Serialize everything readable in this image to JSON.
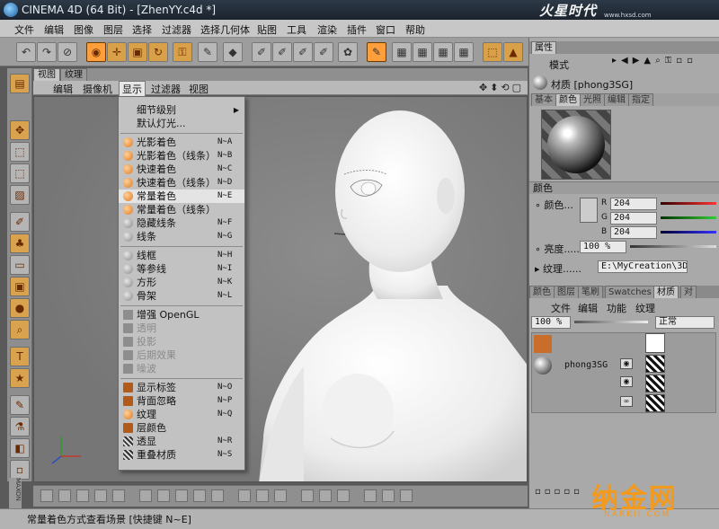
{
  "window": {
    "title": "CINEMA 4D (64 Bit) - [ZhenYY.c4d *]",
    "watermark_top": "火星时代",
    "watermark_url": "www.hxsd.com"
  },
  "menubar": [
    "文件",
    "编辑",
    "图像",
    "图层",
    "选择",
    "过滤器",
    "选择几何体",
    "贴图",
    "工具",
    "渲染",
    "插件",
    "窗口",
    "帮助"
  ],
  "toolbar": {
    "icons": [
      "undo-icon",
      "redo-icon",
      "live-select-icon",
      "move-icon",
      "scale-icon",
      "rotate-icon",
      "lock-icon",
      "tweak-icon",
      "paint-icon",
      "brush-icon",
      "fill-icon",
      "eraser-icon",
      "pick-icon",
      "grid-icon",
      "grid-icon",
      "grid-icon",
      "grid-icon",
      "grid-icon",
      "grid-icon",
      "cube-icon",
      "landscape-icon"
    ]
  },
  "viewport": {
    "tabs": [
      "视图",
      "纹理"
    ],
    "menu": [
      "编辑",
      "摄像机",
      "显示",
      "过滤器",
      "视图"
    ],
    "active_menu": "显示"
  },
  "display_menu": {
    "items": [
      {
        "label": "细节级别",
        "submenu": true
      },
      {
        "label": "默认灯光..."
      },
      {
        "label": "光影着色",
        "shortcut": "N~A"
      },
      {
        "label": "光影着色（线条）",
        "shortcut": "N~B"
      },
      {
        "label": "快速着色",
        "shortcut": "N~C"
      },
      {
        "label": "快速着色（线条）",
        "shortcut": "N~D"
      },
      {
        "label": "常量着色",
        "shortcut": "N~E",
        "highlighted": true
      },
      {
        "label": "常量着色（线条）"
      },
      {
        "label": "隐藏线条",
        "shortcut": "N~F"
      },
      {
        "label": "线条",
        "shortcut": "N~G"
      },
      {
        "label": "线框",
        "shortcut": "N~H"
      },
      {
        "label": "等参线",
        "shortcut": "N~I"
      },
      {
        "label": "方形",
        "shortcut": "N~K"
      },
      {
        "label": "骨架",
        "shortcut": "N~L"
      },
      {
        "label": "增强 OpenGL"
      },
      {
        "label": "透明",
        "disabled": true
      },
      {
        "label": "投影",
        "disabled": true
      },
      {
        "label": "后期效果",
        "disabled": true
      },
      {
        "label": "噪波",
        "disabled": true
      },
      {
        "label": "显示标签",
        "shortcut": "N~O"
      },
      {
        "label": "背面忽略",
        "shortcut": "N~P"
      },
      {
        "label": "纹理",
        "shortcut": "N~Q"
      },
      {
        "label": "层颜色"
      },
      {
        "label": "透显",
        "shortcut": "N~R"
      },
      {
        "label": "重叠材质",
        "shortcut": "N~S"
      }
    ]
  },
  "attributes": {
    "panel_title": "属性",
    "mode_label": "模式",
    "material_name": "材质 [phong3SG]",
    "tabs": [
      "基本",
      "颜色",
      "光照",
      "编辑",
      "指定"
    ],
    "active_tab": "颜色",
    "section": "颜色",
    "color_label": "颜色",
    "r_label": "R",
    "g_label": "G",
    "b_label": "B",
    "r_value": "204",
    "g_value": "204",
    "b_value": "204",
    "brightness_label": "亮度",
    "brightness_value": "100 %",
    "texture_label": "纹理",
    "texture_path": "E:\\MyCreation\\3D"
  },
  "material_manager": {
    "tabs": [
      "颜色",
      "图层",
      "笔刷",
      "Swatches",
      "材质",
      "对"
    ],
    "active_tab": "材质",
    "menu": [
      "文件",
      "编辑",
      "功能",
      "纹理"
    ],
    "opacity": "100 %",
    "blend_mode": "正常",
    "layer_name": "phong3SG"
  },
  "status": {
    "text": "常量着色方式查看场景 [快捷键 N~E]"
  },
  "watermark": {
    "big": "纳金网",
    "small": "NARKII.COM"
  }
}
